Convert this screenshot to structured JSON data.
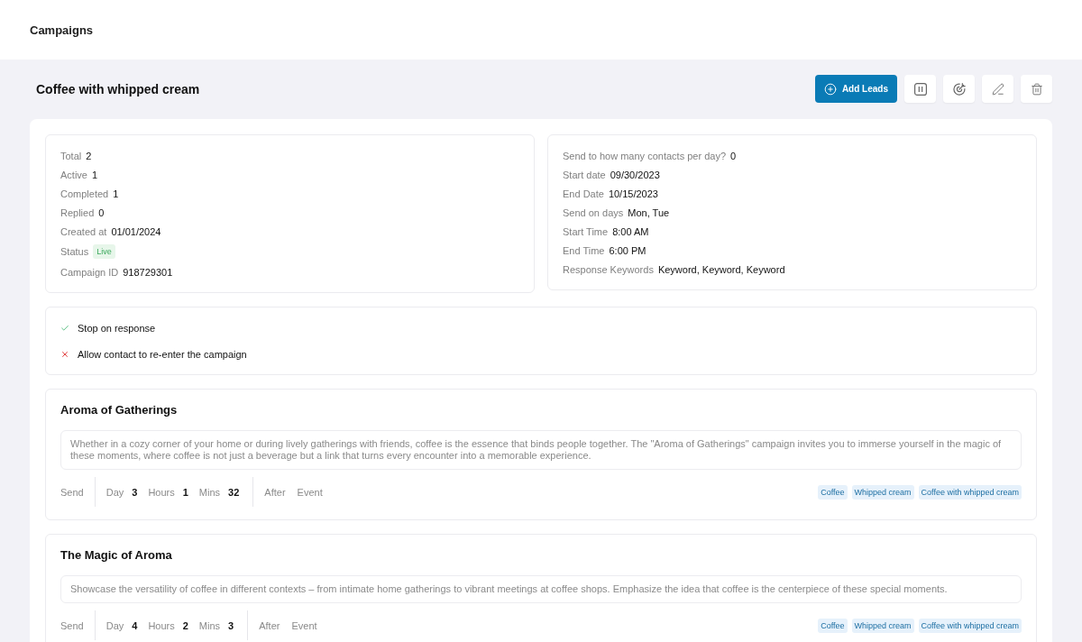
{
  "header": {
    "title": "Campaigns"
  },
  "campaign": {
    "title": "Coffee with whipped cream",
    "add_button": "Add Leads"
  },
  "stats": [
    {
      "label": "Total",
      "value": "2",
      "kind": "text"
    },
    {
      "label": "Active",
      "value": "1",
      "kind": "text"
    },
    {
      "label": "Completed",
      "value": "1",
      "kind": "text"
    },
    {
      "label": "Replied",
      "value": "0",
      "kind": "text"
    },
    {
      "label": "Created at",
      "value": "01/01/2024",
      "kind": "text"
    },
    {
      "label": "Status",
      "value": "Live",
      "kind": "badge"
    },
    {
      "label": "Campaign ID",
      "value": "918729301",
      "kind": "text"
    }
  ],
  "schedule": [
    {
      "label": "Send to how many contacts per day?",
      "value": "0"
    },
    {
      "label": "Start date",
      "value": "09/30/2023"
    },
    {
      "label": "End Date",
      "value": "10/15/2023"
    },
    {
      "label": "Send on days",
      "value": "Mon, Tue"
    },
    {
      "label": "Start Time",
      "value": "8:00 AM"
    },
    {
      "label": "End Time",
      "value": "6:00 PM"
    },
    {
      "label": "Response Keywords",
      "value": "Keyword, Keyword, Keyword"
    }
  ],
  "options": [
    {
      "label": "Stop on response",
      "enabled": true
    },
    {
      "label": "Allow contact to re-enter the campaign",
      "enabled": false
    }
  ],
  "steps": [
    {
      "title": "Aroma of Gatherings",
      "description": "Whether in a cozy corner of your home or during lively gatherings with friends, coffee is the essence that binds people together. The \"Aroma of Gatherings\" campaign invites you to immerse yourself in the magic of these moments, where coffee is not just a beverage but a link that turns every encounter into a memorable experience.",
      "send_label": "Send",
      "delay": [
        {
          "unit": "Day",
          "value": "3"
        },
        {
          "unit": "Hours",
          "value": "1"
        },
        {
          "unit": "Mins",
          "value": "32"
        }
      ],
      "after_label": "After",
      "event_label": "Event",
      "tags": [
        "Coffee",
        "Whipped cream",
        "Coffee with whipped cream"
      ]
    },
    {
      "title": "The Magic of Aroma",
      "description": "Showcase the versatility of coffee in different contexts – from intimate home gatherings to vibrant meetings at coffee shops. Emphasize the idea that coffee is the centerpiece of these special moments.",
      "send_label": "Send",
      "delay": [
        {
          "unit": "Day",
          "value": "4"
        },
        {
          "unit": "Hours",
          "value": "2"
        },
        {
          "unit": "Mins",
          "value": "3"
        }
      ],
      "after_label": "After",
      "event_label": "Event",
      "tags": [
        "Coffee",
        "Whipped cream",
        "Coffee with whipped cream"
      ]
    }
  ]
}
